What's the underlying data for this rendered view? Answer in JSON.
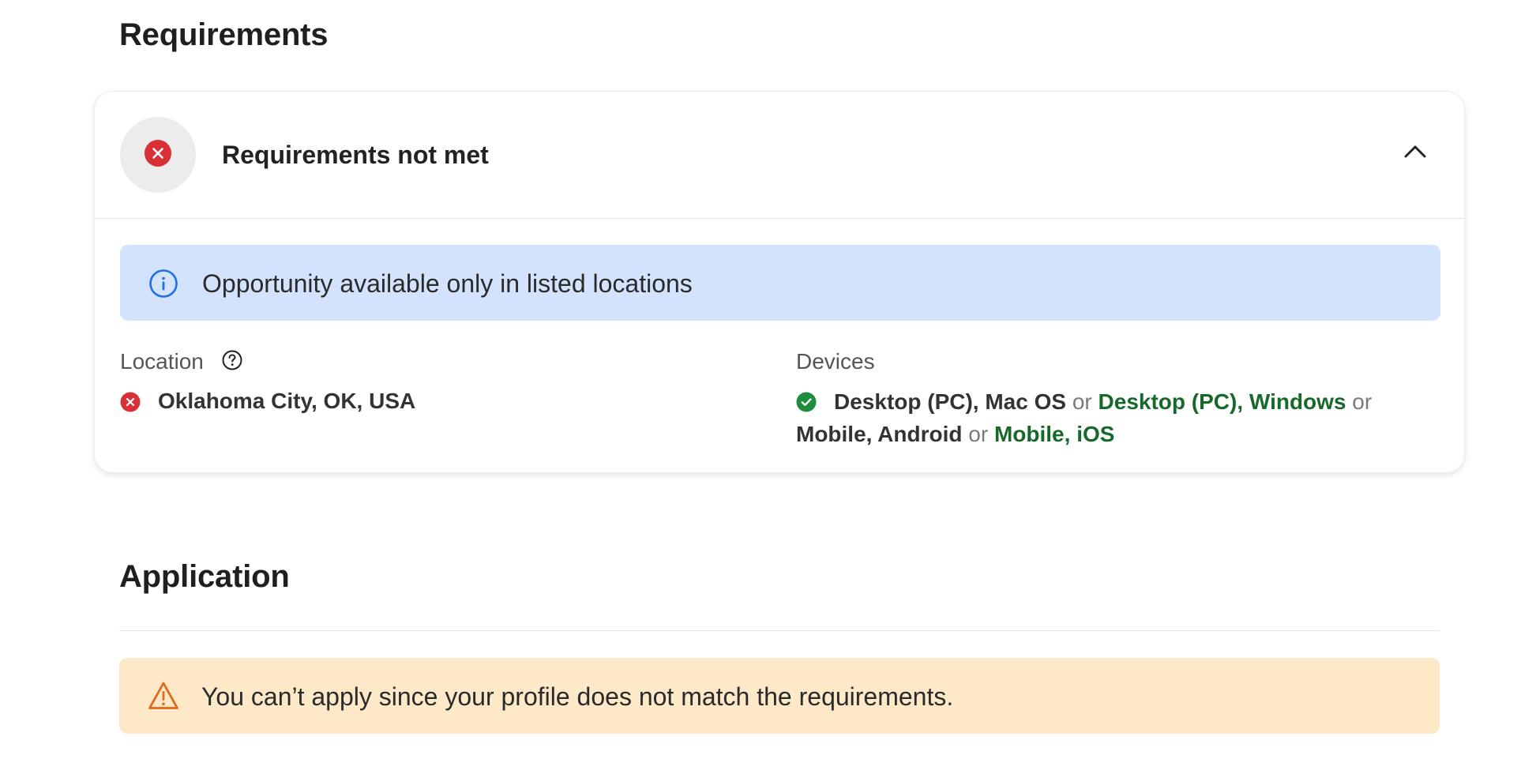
{
  "requirements": {
    "title": "Requirements",
    "card": {
      "status_icon": "error-circle-icon",
      "header": "Requirements not met",
      "toggle_icon": "chevron-up-icon"
    },
    "info_banner": {
      "icon": "info-icon",
      "text": "Opportunity available only in listed locations",
      "bg_color": "#d3e3fd",
      "icon_color": "#1f6fe5"
    },
    "location": {
      "label": "Location",
      "help_icon": "help-circle-icon",
      "status": "not met",
      "value": "Oklahoma City, OK, USA"
    },
    "devices": {
      "label": "Devices",
      "status": "met",
      "items": [
        {
          "text": "Desktop (PC), Mac OS",
          "met": false
        },
        {
          "text": "Desktop (PC), Windows",
          "met": true
        },
        {
          "text": "Mobile, Android",
          "met": false
        },
        {
          "text": "Mobile, iOS",
          "met": true
        }
      ],
      "separator": "or"
    }
  },
  "application": {
    "title": "Application",
    "warning_banner": {
      "icon": "warning-triangle-icon",
      "text": "You can’t apply since your profile does not match the requirements.",
      "bg_color": "#fde8c8",
      "icon_color": "#e06a1b"
    }
  },
  "colors": {
    "error_red": "#d93036",
    "success_green": "#1e8e3e",
    "met_text_green": "#17692b"
  }
}
